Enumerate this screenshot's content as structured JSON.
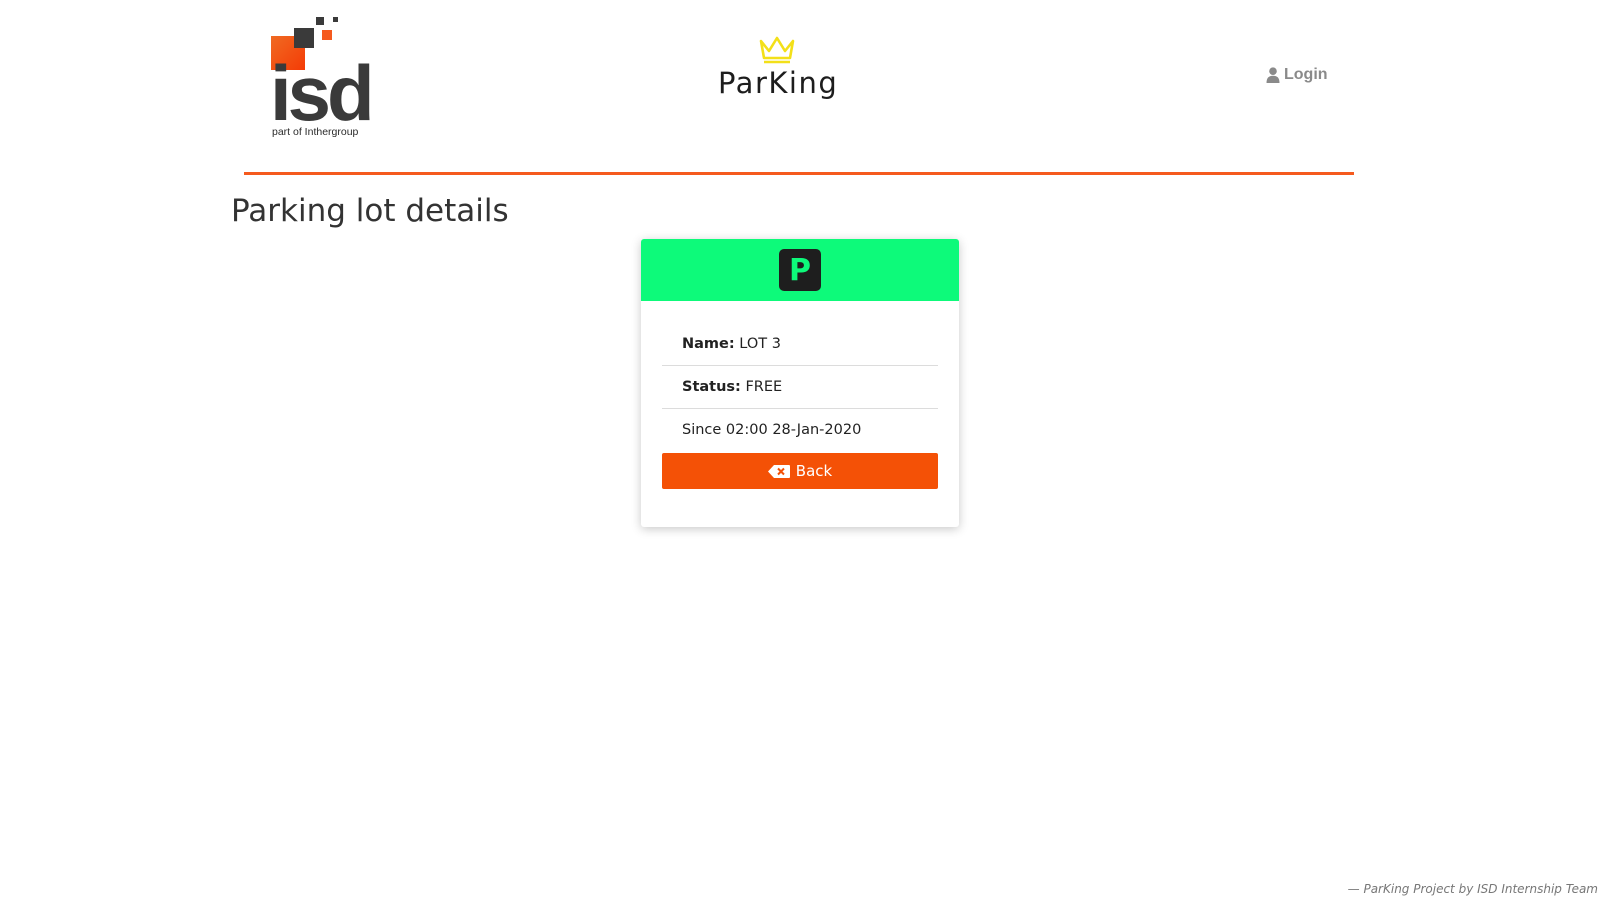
{
  "header": {
    "isd_logo": {
      "text": "isd",
      "subtitle": "part of Inthergroup"
    },
    "brand": {
      "name": "ParKing"
    },
    "login_label": "Login"
  },
  "main": {
    "title": "Parking lot details",
    "card": {
      "badge_letter": "P",
      "name_label": "Name:",
      "name_value": "LOT 3",
      "status_label": "Status:",
      "status_value": "FREE",
      "since_text": "Since 02:00 28-Jan-2020",
      "back_label": "Back"
    }
  },
  "footer": {
    "text": "— ParKing Project by ISD Internship Team"
  },
  "colors": {
    "accent_orange": "#f45106",
    "status_free_green": "#0dfa7a",
    "badge_dark": "#1e1e1e",
    "login_gray": "#8a8a8a",
    "crown_yellow": "#f3e019"
  },
  "icons": {
    "login": "user-icon",
    "back": "backspace-icon",
    "brand": "crown-icon",
    "parking": "parking-p-icon"
  }
}
